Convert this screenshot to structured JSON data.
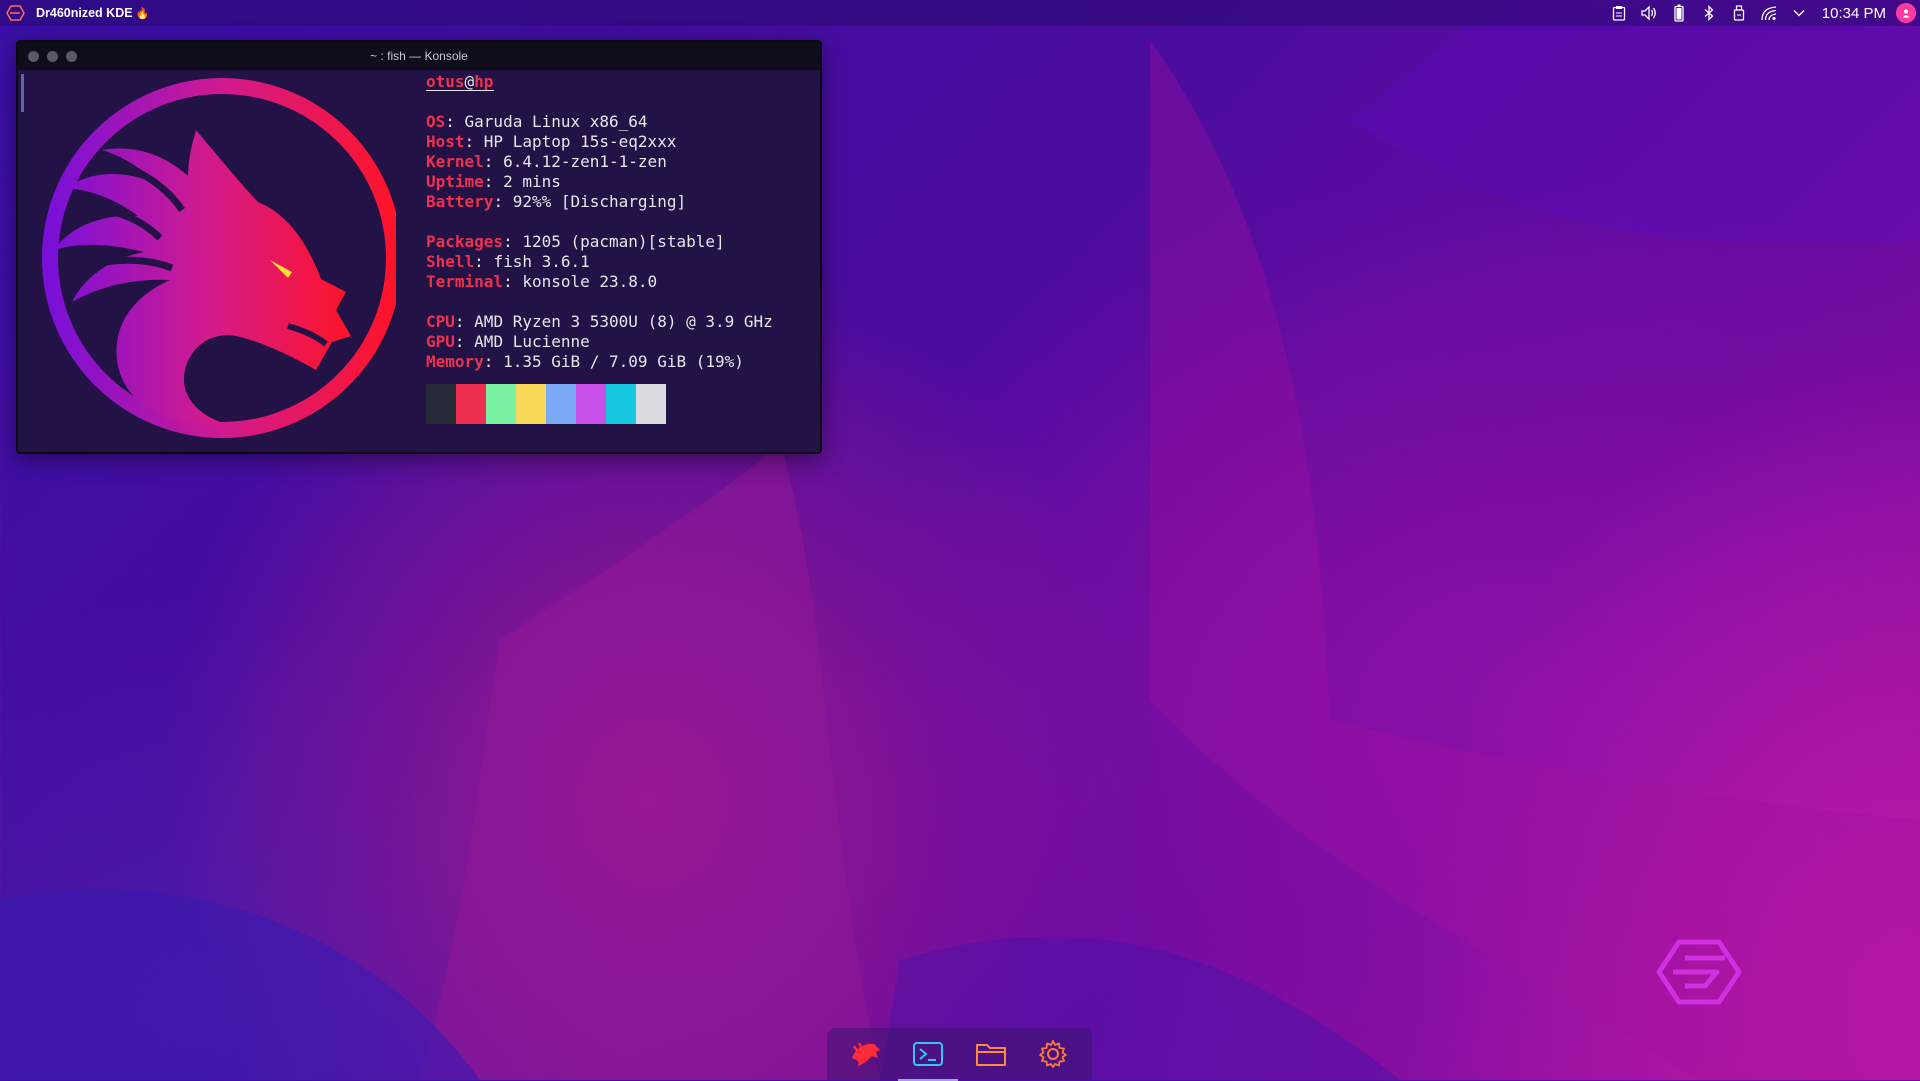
{
  "topbar": {
    "app_title": "Dr460nized KDE",
    "clock": "10:34 PM",
    "tray_icons": [
      "clipboard-icon",
      "volume-icon",
      "battery-icon",
      "bluetooth-icon",
      "usb-device-icon",
      "network-icon",
      "chevron-down-icon"
    ]
  },
  "window": {
    "title": "~ : fish — Konsole"
  },
  "neofetch": {
    "user": "otus",
    "at": "@",
    "host": "hp",
    "rows": [
      {
        "key": "OS",
        "value": ": Garuda Linux x86_64"
      },
      {
        "key": "Host",
        "value": ": HP Laptop 15s-eq2xxx"
      },
      {
        "key": "Kernel",
        "value": ": 6.4.12-zen1-1-zen"
      },
      {
        "key": "Uptime",
        "value": ": 2 mins"
      },
      {
        "key": "Battery",
        "value": ": 92%% [Discharging]"
      },
      {
        "key": "Packages",
        "value": ": 1205 (pacman)[stable]"
      },
      {
        "key": "Shell",
        "value": ": fish 3.6.1"
      },
      {
        "key": "Terminal",
        "value": ": konsole 23.8.0"
      },
      {
        "key": "CPU",
        "value": ": AMD Ryzen 3 5300U (8) @ 3.9 GHz"
      },
      {
        "key": "GPU",
        "value": ": AMD Lucienne"
      },
      {
        "key": "Memory",
        "value": ": 1.35 GiB / 7.09 GiB (19%)"
      }
    ],
    "palette": [
      "#262a36",
      "#ee2e50",
      "#78f0a0",
      "#f8d858",
      "#7aaaf8",
      "#c850e8",
      "#18c8e0",
      "#dcdce0"
    ]
  },
  "dock": {
    "items": [
      "garuda-launcher-icon",
      "terminal-icon",
      "folder-icon",
      "settings-gear-icon"
    ]
  }
}
